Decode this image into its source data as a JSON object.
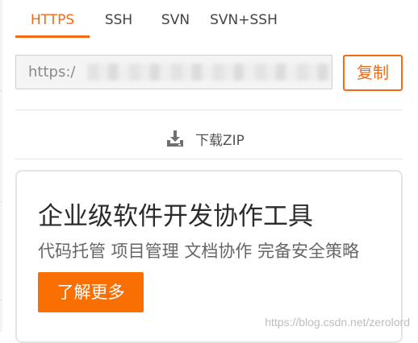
{
  "tabs": [
    {
      "label": "HTTPS",
      "active": true
    },
    {
      "label": "SSH",
      "active": false
    },
    {
      "label": "SVN",
      "active": false
    },
    {
      "label": "SVN+SSH",
      "active": false
    }
  ],
  "clone": {
    "url_prefix": "https:/",
    "copy_label": "复制"
  },
  "download": {
    "label": "下载ZIP",
    "icon": "download-tray-icon"
  },
  "promo": {
    "title": "企业级软件开发协作工具",
    "subtitle": "代码托管 项目管理 文档协作 完备安全策略",
    "button_label": "了解更多"
  },
  "watermark": "https://blog.csdn.net/zerolord",
  "colors": {
    "accent": "#f36b16",
    "button_fill": "#fa6f02",
    "input_bg": "#f4f4f4",
    "border": "#e4e4e4"
  }
}
